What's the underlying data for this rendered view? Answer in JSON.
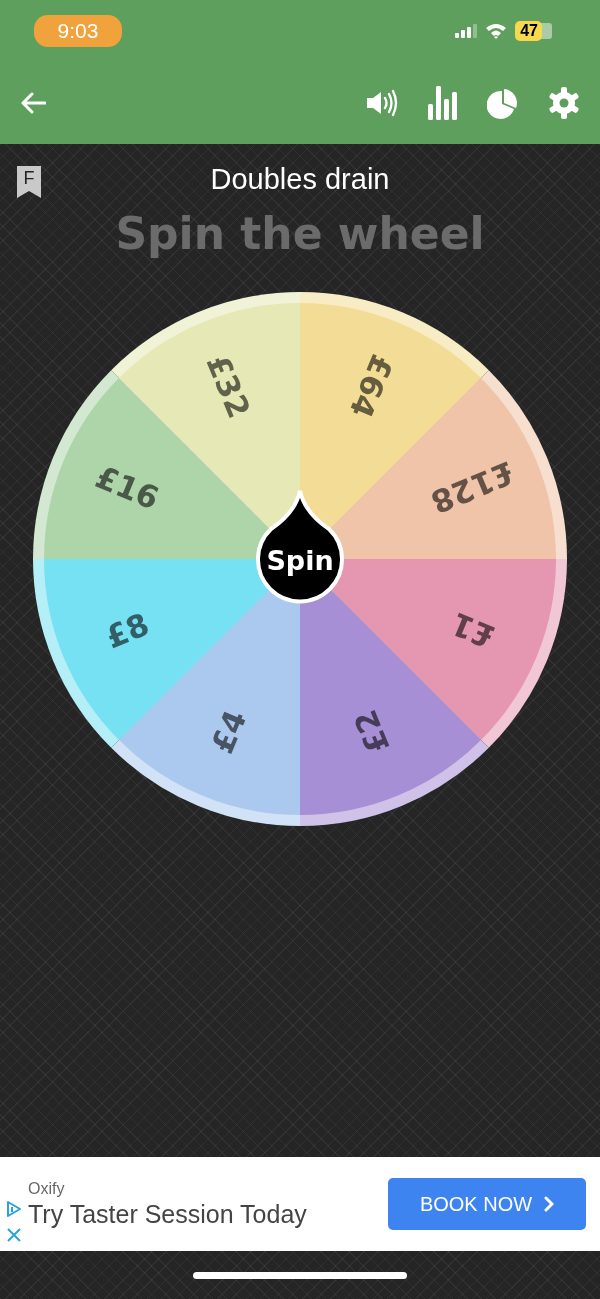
{
  "status_bar": {
    "time": "9:03",
    "battery": "47"
  },
  "title": "Doubles drain",
  "badge": "F",
  "heading": "Spin the wheel",
  "wheel": {
    "spin_button": "Spin",
    "segments": [
      {
        "label": "£64",
        "color": "#f3dd96"
      },
      {
        "label": "£128",
        "color": "#f0c4a9"
      },
      {
        "label": "£1",
        "color": "#e597b2"
      },
      {
        "label": "£2",
        "color": "#a78fd6"
      },
      {
        "label": "£4",
        "color": "#abc9ef"
      },
      {
        "label": "£8",
        "color": "#76e1f3"
      },
      {
        "label": "£16",
        "color": "#aed5a9"
      },
      {
        "label": "£32",
        "color": "#e6e9b5"
      }
    ]
  },
  "ad": {
    "advertiser": "Oxify",
    "headline": "Try Taster Session Today",
    "button": "BOOK NOW"
  }
}
